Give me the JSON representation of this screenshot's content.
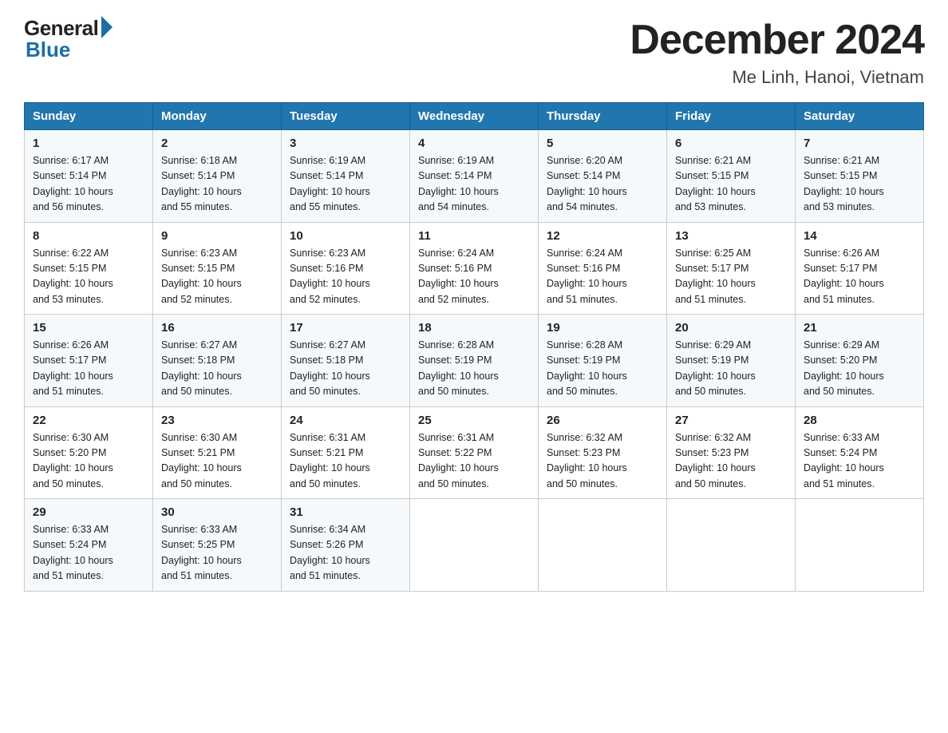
{
  "header": {
    "logo_general": "General",
    "logo_blue": "Blue",
    "title": "December 2024",
    "subtitle": "Me Linh, Hanoi, Vietnam"
  },
  "days_of_week": [
    "Sunday",
    "Monday",
    "Tuesday",
    "Wednesday",
    "Thursday",
    "Friday",
    "Saturday"
  ],
  "weeks": [
    [
      {
        "day": "1",
        "sunrise": "6:17 AM",
        "sunset": "5:14 PM",
        "daylight": "10 hours and 56 minutes."
      },
      {
        "day": "2",
        "sunrise": "6:18 AM",
        "sunset": "5:14 PM",
        "daylight": "10 hours and 55 minutes."
      },
      {
        "day": "3",
        "sunrise": "6:19 AM",
        "sunset": "5:14 PM",
        "daylight": "10 hours and 55 minutes."
      },
      {
        "day": "4",
        "sunrise": "6:19 AM",
        "sunset": "5:14 PM",
        "daylight": "10 hours and 54 minutes."
      },
      {
        "day": "5",
        "sunrise": "6:20 AM",
        "sunset": "5:14 PM",
        "daylight": "10 hours and 54 minutes."
      },
      {
        "day": "6",
        "sunrise": "6:21 AM",
        "sunset": "5:15 PM",
        "daylight": "10 hours and 53 minutes."
      },
      {
        "day": "7",
        "sunrise": "6:21 AM",
        "sunset": "5:15 PM",
        "daylight": "10 hours and 53 minutes."
      }
    ],
    [
      {
        "day": "8",
        "sunrise": "6:22 AM",
        "sunset": "5:15 PM",
        "daylight": "10 hours and 53 minutes."
      },
      {
        "day": "9",
        "sunrise": "6:23 AM",
        "sunset": "5:15 PM",
        "daylight": "10 hours and 52 minutes."
      },
      {
        "day": "10",
        "sunrise": "6:23 AM",
        "sunset": "5:16 PM",
        "daylight": "10 hours and 52 minutes."
      },
      {
        "day": "11",
        "sunrise": "6:24 AM",
        "sunset": "5:16 PM",
        "daylight": "10 hours and 52 minutes."
      },
      {
        "day": "12",
        "sunrise": "6:24 AM",
        "sunset": "5:16 PM",
        "daylight": "10 hours and 51 minutes."
      },
      {
        "day": "13",
        "sunrise": "6:25 AM",
        "sunset": "5:17 PM",
        "daylight": "10 hours and 51 minutes."
      },
      {
        "day": "14",
        "sunrise": "6:26 AM",
        "sunset": "5:17 PM",
        "daylight": "10 hours and 51 minutes."
      }
    ],
    [
      {
        "day": "15",
        "sunrise": "6:26 AM",
        "sunset": "5:17 PM",
        "daylight": "10 hours and 51 minutes."
      },
      {
        "day": "16",
        "sunrise": "6:27 AM",
        "sunset": "5:18 PM",
        "daylight": "10 hours and 50 minutes."
      },
      {
        "day": "17",
        "sunrise": "6:27 AM",
        "sunset": "5:18 PM",
        "daylight": "10 hours and 50 minutes."
      },
      {
        "day": "18",
        "sunrise": "6:28 AM",
        "sunset": "5:19 PM",
        "daylight": "10 hours and 50 minutes."
      },
      {
        "day": "19",
        "sunrise": "6:28 AM",
        "sunset": "5:19 PM",
        "daylight": "10 hours and 50 minutes."
      },
      {
        "day": "20",
        "sunrise": "6:29 AM",
        "sunset": "5:19 PM",
        "daylight": "10 hours and 50 minutes."
      },
      {
        "day": "21",
        "sunrise": "6:29 AM",
        "sunset": "5:20 PM",
        "daylight": "10 hours and 50 minutes."
      }
    ],
    [
      {
        "day": "22",
        "sunrise": "6:30 AM",
        "sunset": "5:20 PM",
        "daylight": "10 hours and 50 minutes."
      },
      {
        "day": "23",
        "sunrise": "6:30 AM",
        "sunset": "5:21 PM",
        "daylight": "10 hours and 50 minutes."
      },
      {
        "day": "24",
        "sunrise": "6:31 AM",
        "sunset": "5:21 PM",
        "daylight": "10 hours and 50 minutes."
      },
      {
        "day": "25",
        "sunrise": "6:31 AM",
        "sunset": "5:22 PM",
        "daylight": "10 hours and 50 minutes."
      },
      {
        "day": "26",
        "sunrise": "6:32 AM",
        "sunset": "5:23 PM",
        "daylight": "10 hours and 50 minutes."
      },
      {
        "day": "27",
        "sunrise": "6:32 AM",
        "sunset": "5:23 PM",
        "daylight": "10 hours and 50 minutes."
      },
      {
        "day": "28",
        "sunrise": "6:33 AM",
        "sunset": "5:24 PM",
        "daylight": "10 hours and 51 minutes."
      }
    ],
    [
      {
        "day": "29",
        "sunrise": "6:33 AM",
        "sunset": "5:24 PM",
        "daylight": "10 hours and 51 minutes."
      },
      {
        "day": "30",
        "sunrise": "6:33 AM",
        "sunset": "5:25 PM",
        "daylight": "10 hours and 51 minutes."
      },
      {
        "day": "31",
        "sunrise": "6:34 AM",
        "sunset": "5:26 PM",
        "daylight": "10 hours and 51 minutes."
      },
      null,
      null,
      null,
      null
    ]
  ],
  "label_sunrise": "Sunrise:",
  "label_sunset": "Sunset:",
  "label_daylight": "Daylight:"
}
